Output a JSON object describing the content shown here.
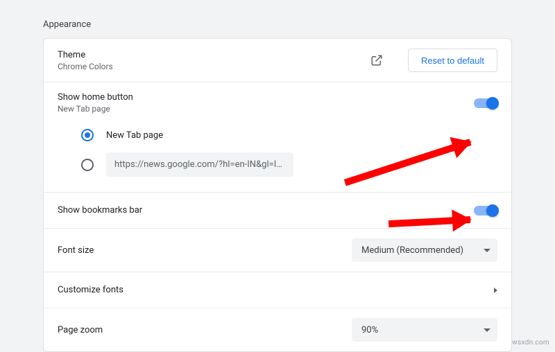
{
  "section": {
    "heading": "Appearance"
  },
  "theme": {
    "title": "Theme",
    "sub": "Chrome Colors",
    "reset": "Reset to default"
  },
  "home": {
    "title": "Show home button",
    "sub": "New Tab page",
    "opt_newtab": "New Tab page",
    "opt_url": "https://news.google.com/?hl=en-IN&gl=IN&c..."
  },
  "bookmarks": {
    "title": "Show bookmarks bar"
  },
  "font": {
    "title": "Font size",
    "value": "Medium (Recommended)"
  },
  "customize": {
    "title": "Customize fonts"
  },
  "zoom": {
    "title": "Page zoom",
    "value": "90%"
  },
  "watermark": "wsxdn.com"
}
